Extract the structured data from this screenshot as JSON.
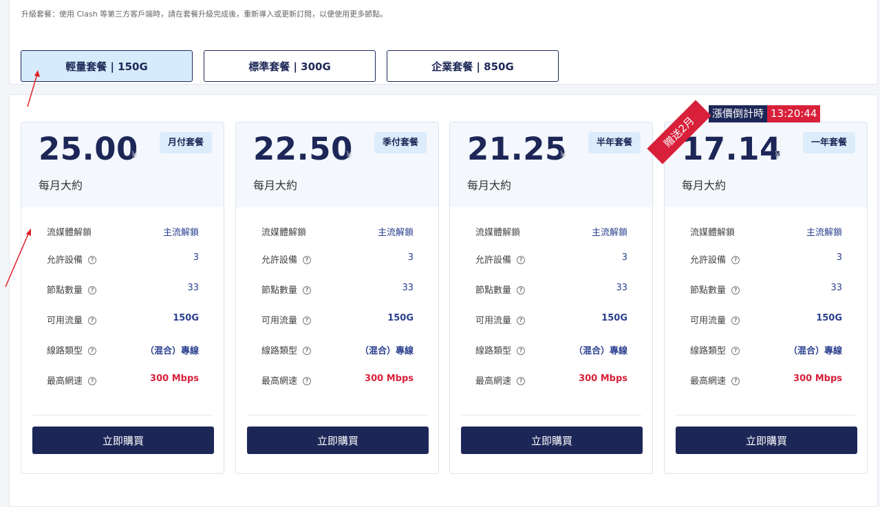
{
  "notes": {
    "line1": "",
    "line2": "升級套餐：使用 Clash 等第三方客戶端時，請在套餐升級完成後，重新導入或更新訂閱，以便使用更多節點。"
  },
  "tiers": [
    {
      "label": "輕量套餐 | 150G",
      "active": true
    },
    {
      "label": "標準套餐 | 300G",
      "active": false
    },
    {
      "label": "企業套餐 | 850G",
      "active": false
    }
  ],
  "countdown": {
    "label": "漲價倒計時",
    "time": "13:20:44"
  },
  "gift_ribbon": "贈送2月",
  "currency_symbol": "¥",
  "approx_label": "每月大約",
  "buy_label": "立即購買",
  "plans": [
    {
      "price": "25.00",
      "period": "月付套餐"
    },
    {
      "price": "22.50",
      "period": "季付套餐"
    },
    {
      "price": "21.25",
      "period": "半年套餐"
    },
    {
      "price": "17.14",
      "period": "一年套餐"
    }
  ],
  "features": [
    {
      "label": "流媒體解鎖",
      "value": "主流解鎖",
      "help": false,
      "style": "normal"
    },
    {
      "label": "允許設備",
      "value": "3",
      "help": true,
      "style": "normal"
    },
    {
      "label": "節點數量",
      "value": "33",
      "help": true,
      "style": "normal"
    },
    {
      "label": "可用流量",
      "value": "150G",
      "help": true,
      "style": "bold"
    },
    {
      "label": "線路類型",
      "value": "（混合）專線",
      "help": true,
      "style": "bold"
    },
    {
      "label": "最高網速",
      "value": "300 Mbps",
      "help": true,
      "style": "red"
    }
  ],
  "colors": {
    "navy": "#1d2757",
    "red": "#d8203a",
    "active_tier_bg": "#d6ebfb"
  }
}
